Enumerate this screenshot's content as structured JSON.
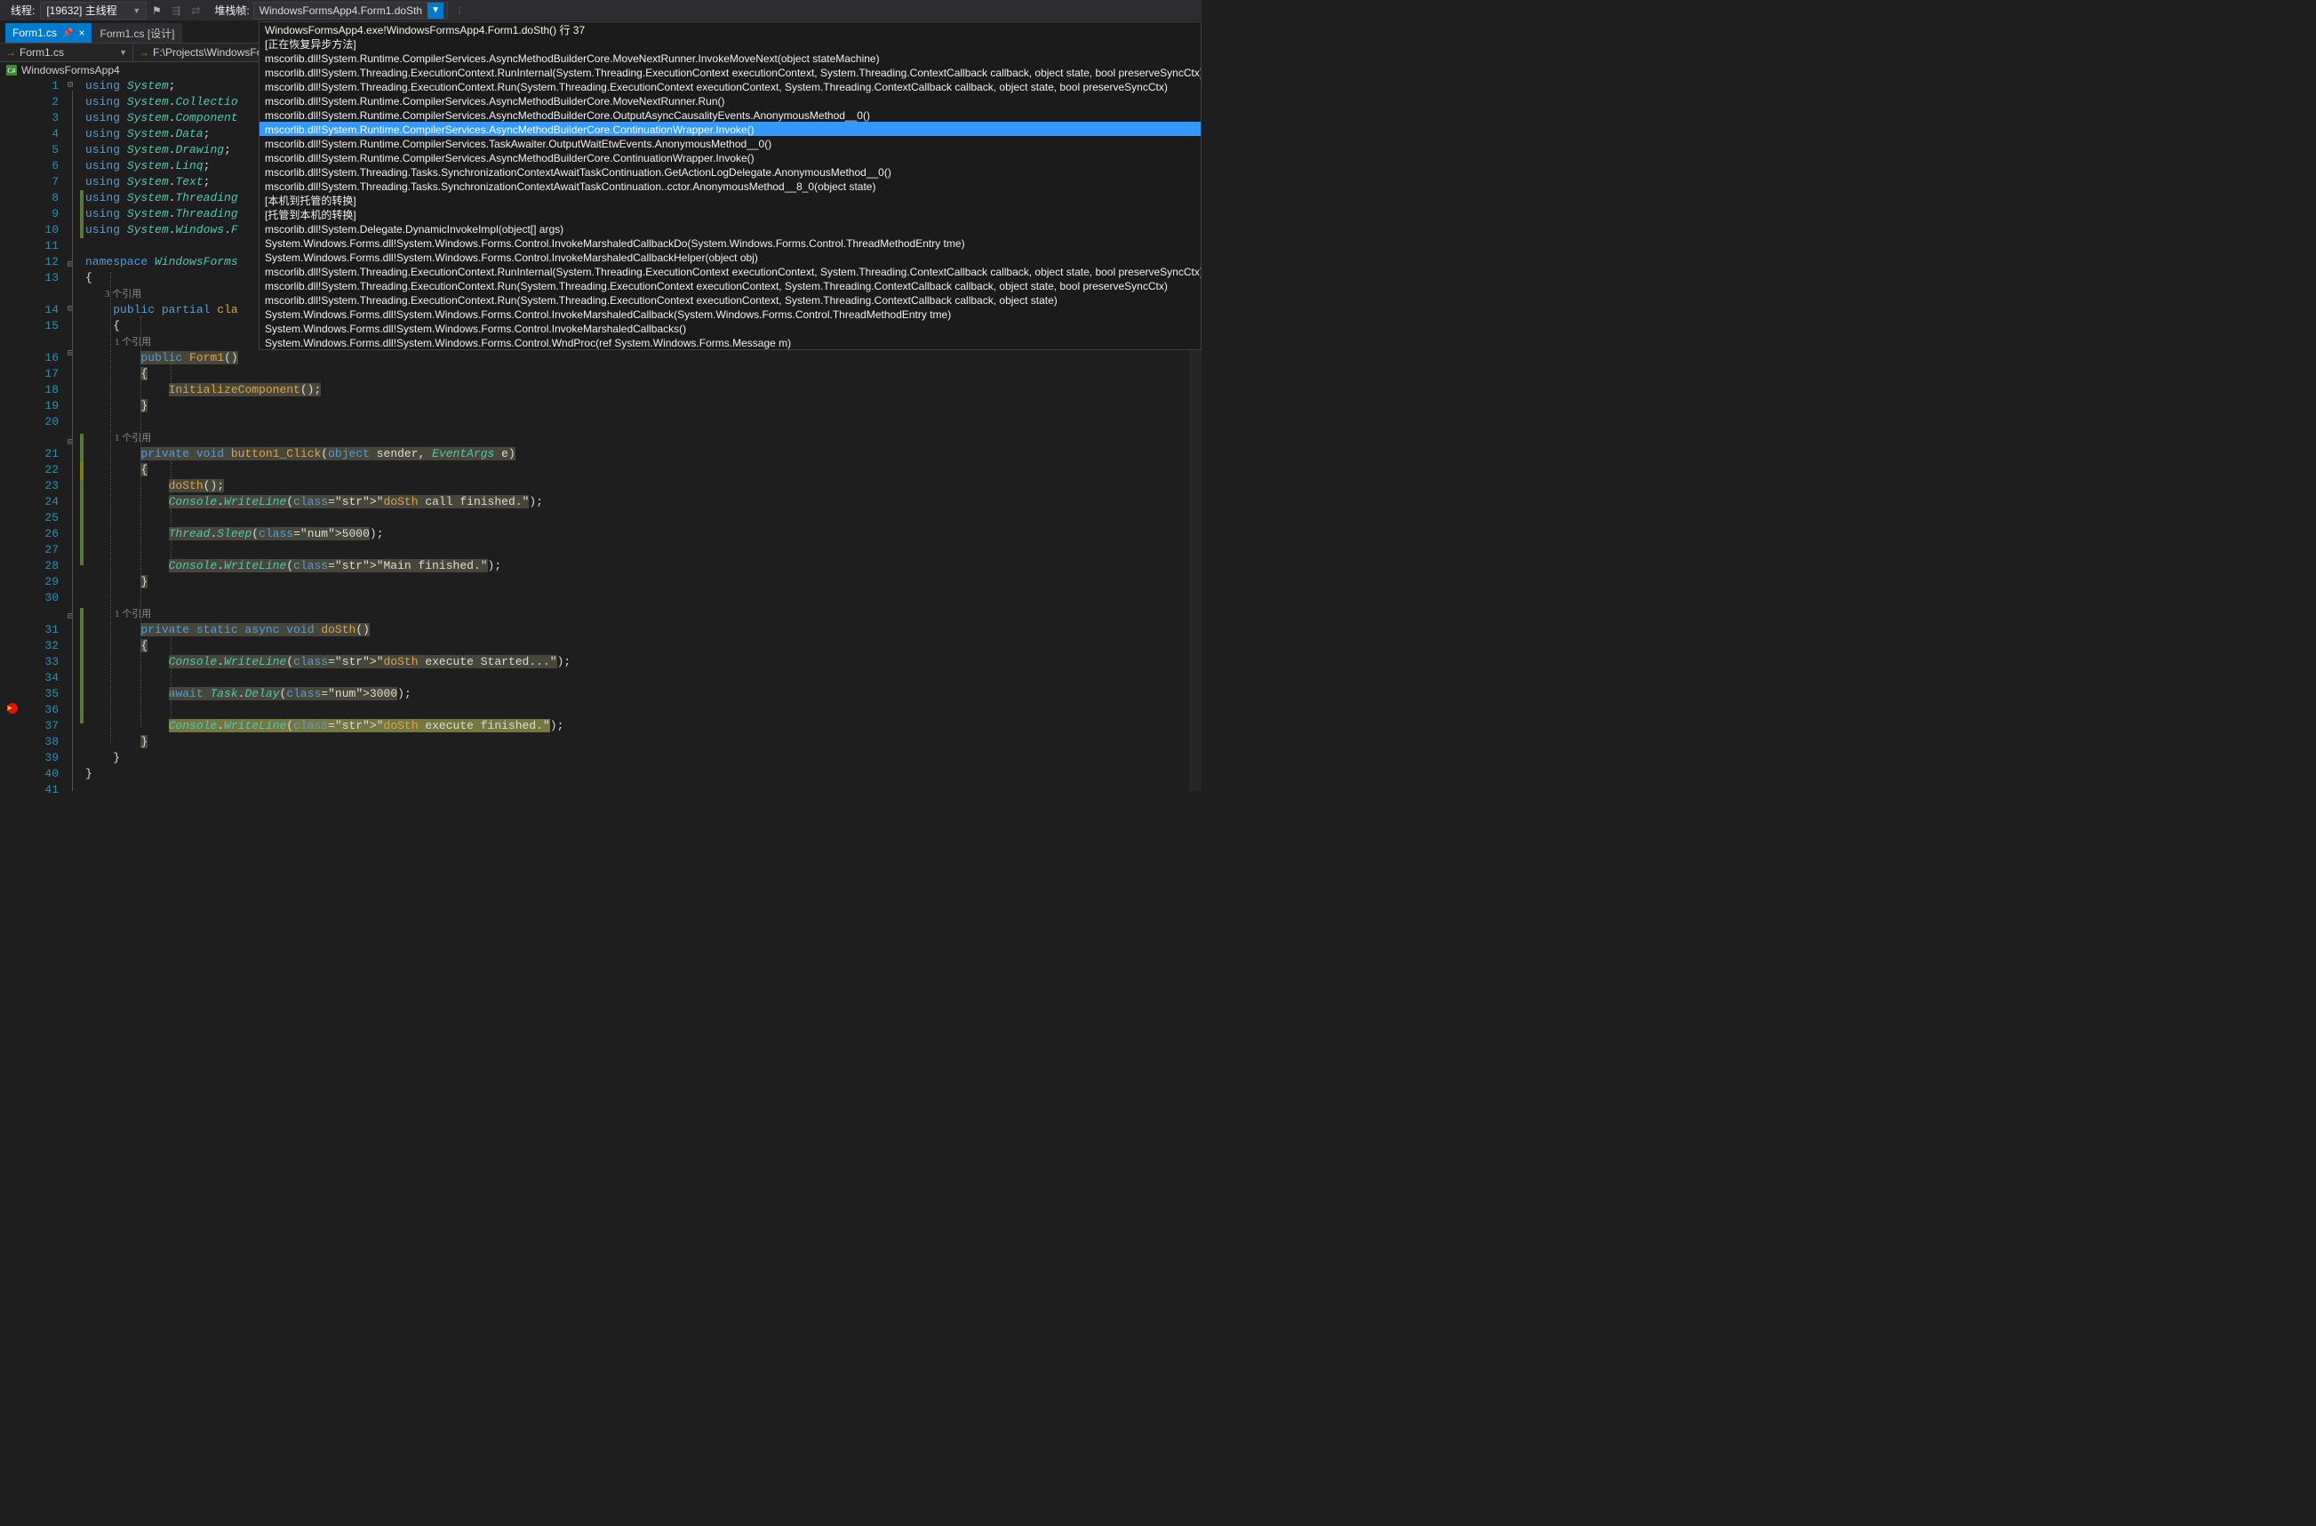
{
  "toolbar": {
    "thread_label": "线程:",
    "thread_value": "[19632] 主线程",
    "stackframe_label": "堆栈帧:",
    "stackframe_value": "WindowsFormsApp4.Form1.doSth"
  },
  "tabs": [
    {
      "label": "Form1.cs",
      "active": true,
      "pinned": true,
      "closable": true
    },
    {
      "label": "Form1.cs [设计]",
      "active": false
    }
  ],
  "navbar": {
    "left": "Form1.cs",
    "right": "F:\\Projects\\WindowsFor"
  },
  "project_row": "WindowsFormsApp4",
  "codelens": {
    "class_refs": "3 个引用",
    "ctor_refs": "1 个引用",
    "btn_refs": "1 个引用",
    "dosth_refs": "1 个引用"
  },
  "code": {
    "l1": "using System;",
    "l2": "using System.Collectio",
    "l3": "using System.Component",
    "l4": "using System.Data;",
    "l5": "using System.Drawing;",
    "l6": "using System.Linq;",
    "l7": "using System.Text;",
    "l8": "using System.Threading",
    "l9": "using System.Threading",
    "l10": "using System.Windows.F",
    "l11": "",
    "l12": "namespace WindowsForms",
    "l13": "{",
    "l14": "    public partial cla",
    "l15": "    {",
    "l16": "        public Form1()",
    "l17": "        {",
    "l18": "            InitializeComponent();",
    "l19": "        }",
    "l20": "",
    "l21": "        private void button1_Click(object sender, EventArgs e)",
    "l22": "        {",
    "l23": "            doSth();",
    "l24": "            Console.WriteLine(\"doSth call finished.\");",
    "l25": "",
    "l26": "            Thread.Sleep(5000);",
    "l27": "",
    "l28": "            Console.WriteLine(\"Main finished.\");",
    "l29": "        }",
    "l30": "",
    "l31": "        private static async void doSth()",
    "l32": "        {",
    "l33": "            Console.WriteLine(\"doSth execute Started...\");",
    "l34": "",
    "l35": "            await Task.Delay(3000);",
    "l36": "",
    "l37": "            Console.WriteLine(\"doSth execute finished.\");",
    "l38": "        }",
    "l39": "    }",
    "l40": "}",
    "l41": ""
  },
  "callstack": [
    "WindowsFormsApp4.exe!WindowsFormsApp4.Form1.doSth() 行 37",
    "[正在恢复异步方法]",
    "mscorlib.dll!System.Runtime.CompilerServices.AsyncMethodBuilderCore.MoveNextRunner.InvokeMoveNext(object stateMachine)",
    "mscorlib.dll!System.Threading.ExecutionContext.RunInternal(System.Threading.ExecutionContext executionContext, System.Threading.ContextCallback callback, object state, bool preserveSyncCtx)",
    "mscorlib.dll!System.Threading.ExecutionContext.Run(System.Threading.ExecutionContext executionContext, System.Threading.ContextCallback callback, object state, bool preserveSyncCtx)",
    "mscorlib.dll!System.Runtime.CompilerServices.AsyncMethodBuilderCore.MoveNextRunner.Run()",
    "mscorlib.dll!System.Runtime.CompilerServices.AsyncMethodBuilderCore.OutputAsyncCausalityEvents.AnonymousMethod__0()",
    "mscorlib.dll!System.Runtime.CompilerServices.AsyncMethodBuilderCore.ContinuationWrapper.Invoke()",
    "mscorlib.dll!System.Runtime.CompilerServices.TaskAwaiter.OutputWaitEtwEvents.AnonymousMethod__0()",
    "mscorlib.dll!System.Runtime.CompilerServices.AsyncMethodBuilderCore.ContinuationWrapper.Invoke()",
    "mscorlib.dll!System.Threading.Tasks.SynchronizationContextAwaitTaskContinuation.GetActionLogDelegate.AnonymousMethod__0()",
    "mscorlib.dll!System.Threading.Tasks.SynchronizationContextAwaitTaskContinuation..cctor.AnonymousMethod__8_0(object state)",
    "[本机到托管的转换]",
    "[托管到本机的转换]",
    "mscorlib.dll!System.Delegate.DynamicInvokeImpl(object[] args)",
    "System.Windows.Forms.dll!System.Windows.Forms.Control.InvokeMarshaledCallbackDo(System.Windows.Forms.Control.ThreadMethodEntry tme)",
    "System.Windows.Forms.dll!System.Windows.Forms.Control.InvokeMarshaledCallbackHelper(object obj)",
    "mscorlib.dll!System.Threading.ExecutionContext.RunInternal(System.Threading.ExecutionContext executionContext, System.Threading.ContextCallback callback, object state, bool preserveSyncCtx)",
    "mscorlib.dll!System.Threading.ExecutionContext.Run(System.Threading.ExecutionContext executionContext, System.Threading.ContextCallback callback, object state, bool preserveSyncCtx)",
    "mscorlib.dll!System.Threading.ExecutionContext.Run(System.Threading.ExecutionContext executionContext, System.Threading.ContextCallback callback, object state)",
    "System.Windows.Forms.dll!System.Windows.Forms.Control.InvokeMarshaledCallback(System.Windows.Forms.Control.ThreadMethodEntry tme)",
    "System.Windows.Forms.dll!System.Windows.Forms.Control.InvokeMarshaledCallbacks()",
    "System.Windows.Forms.dll!System.Windows.Forms.Control.WndProc(ref System.Windows.Forms.Message m)"
  ],
  "callstack_selected_index": 7
}
